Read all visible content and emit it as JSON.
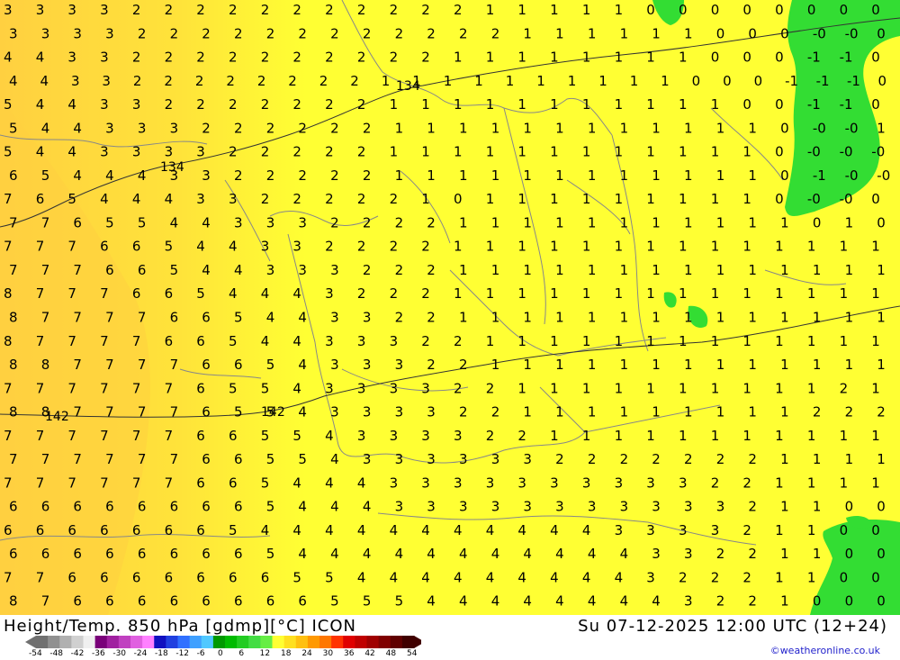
{
  "title": "Height/Temp. 850 hPa [gdmp][°C] ICON",
  "datetime": "Su 07-12-2025 12:00 UTC (12+24)",
  "credit": "©weatheronline.co.uk",
  "colors": {
    "yellow": "#ffff33",
    "yellow_orange": "#ffe33a",
    "orange": "#ffd040",
    "green": "#33dd33",
    "border": "#888888"
  },
  "contour_labels": [
    "134",
    "134",
    "142",
    "142"
  ],
  "legend": {
    "ticks": [
      "-54",
      "-48",
      "-42",
      "-36",
      "-30",
      "-24",
      "-18",
      "-12",
      "-6",
      "0",
      "6",
      "12",
      "18",
      "24",
      "30",
      "36",
      "42",
      "48",
      "54"
    ],
    "colors": [
      "#707070",
      "#909090",
      "#b0b0b0",
      "#d0d0d0",
      "#f0f0f0",
      "#7a007a",
      "#a020a0",
      "#c040c0",
      "#e060e0",
      "#ff80ff",
      "#1010c0",
      "#2040e0",
      "#3070ff",
      "#40a0ff",
      "#50c8ff",
      "#009900",
      "#00bb00",
      "#22cc22",
      "#44dd44",
      "#66ee44",
      "#ffff33",
      "#ffe020",
      "#ffc010",
      "#ff9900",
      "#ff7700",
      "#ff3300",
      "#e00000",
      "#c00000",
      "#a00000",
      "#800000",
      "#600000",
      "#400000"
    ]
  },
  "grid_values": [
    "3333222222222221111100000000",
    "3333222222222222111111000-0-00",
    "4433222222222211111111000-1-10",
    "4433222222221111111111000-1-1-10",
    "5443322222221111111111100-1-10",
    "5443332222221111111111110-0-01",
    "5443333222221111111111110-0-0-0",
    "6544433222221111111111110-1-0-0",
    "7654443322222101111111110-0-00",
    "7765544333222211111111111010",
    "7776654433222211111111111111",
    "7776654433322211111111111111",
    "8777665444322211111111111111",
    "8777766544332211111111111111",
    "8777766544333221111111111111",
    "8877776654333221111111111111",
    "7777776554333322111111111121",
    "8877776554333322111111111222",
    "7777776655433332211111111111",
    "7777776655433333322222221111",
    "7777776654443333333333221111",
    "6666666654443333333333321100",
    "6666666544444444444333321100",
    "6666666654444444444433221100",
    "7766666665544444444432221100",
    "8766666666555444444443221000"
  ]
}
